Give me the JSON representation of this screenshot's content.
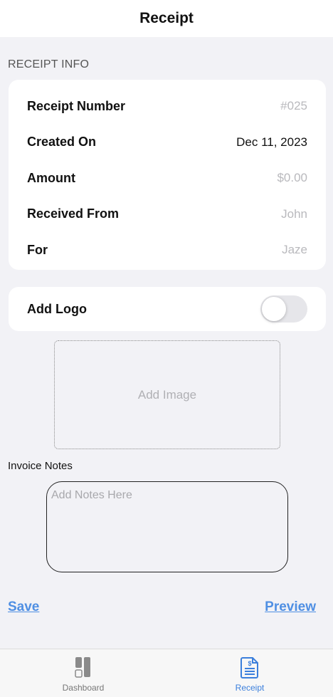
{
  "header": {
    "title": "Receipt"
  },
  "receipt_info": {
    "section_label": "RECEIPT INFO",
    "rows": [
      {
        "label": "Receipt Number",
        "value": "#025"
      },
      {
        "label": "Created On",
        "value": "Dec 11, 2023"
      },
      {
        "label": "Amount",
        "value": "$0.00"
      },
      {
        "label": "Received From",
        "value": "John"
      },
      {
        "label": "For",
        "value": "Jaze"
      }
    ]
  },
  "logo": {
    "label": "Add Logo",
    "toggle_on": false,
    "add_image_label": "Add Image"
  },
  "notes": {
    "label": "Invoice Notes",
    "placeholder": "Add Notes Here",
    "value": ""
  },
  "actions": {
    "save_label": "Save",
    "preview_label": "Preview"
  },
  "tabbar": {
    "tabs": [
      {
        "label": "Dashboard",
        "icon": "dashboard-icon",
        "active": false
      },
      {
        "label": "Receipt",
        "icon": "receipt-icon",
        "active": true
      }
    ]
  },
  "colors": {
    "accent": "#3b7fdc",
    "link": "#4f8fe3",
    "background": "#f2f2f6"
  }
}
